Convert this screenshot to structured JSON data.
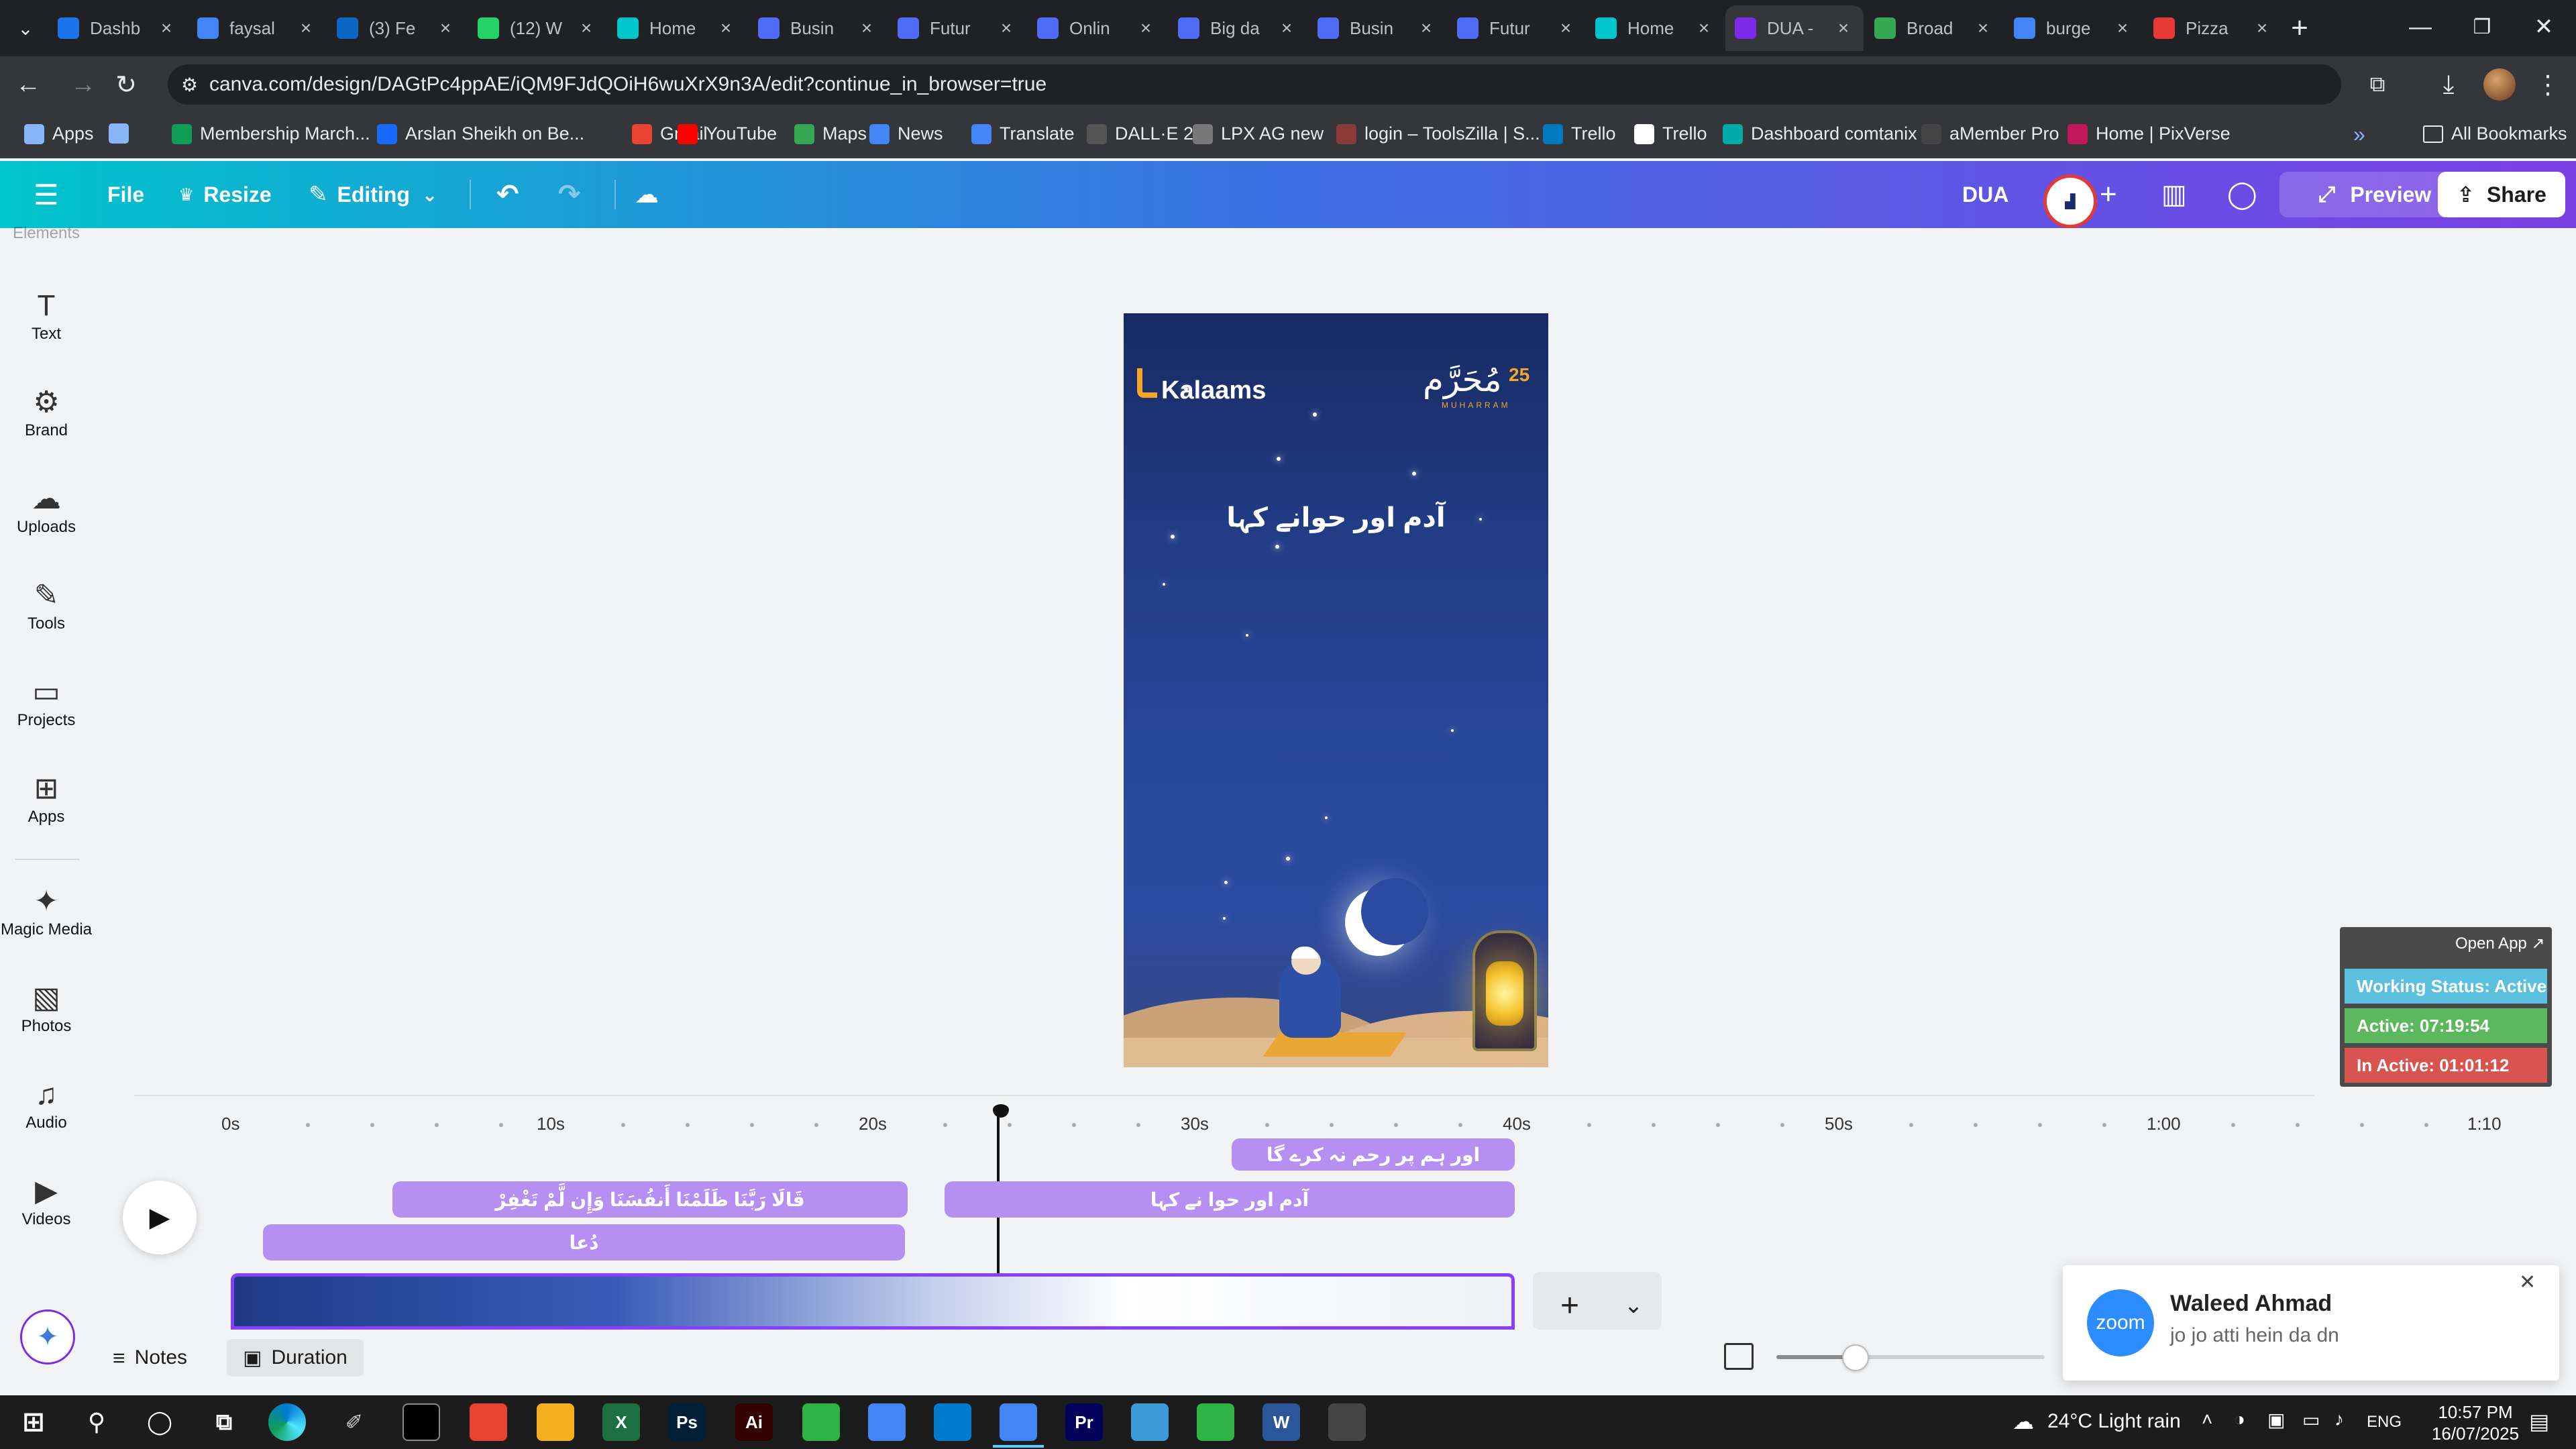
{
  "browser": {
    "tabs": [
      {
        "title": "Dashb",
        "icon": "dashboard-icon",
        "color": "#1a73e8"
      },
      {
        "title": "faysal",
        "icon": "google-icon",
        "color": "#4285f4"
      },
      {
        "title": "(3) Fe",
        "icon": "linkedin-icon",
        "color": "#0a66c2"
      },
      {
        "title": "(12) W",
        "icon": "whatsapp-icon",
        "color": "#25d366"
      },
      {
        "title": "Home",
        "icon": "canva-icon",
        "color": "#00c4cc"
      },
      {
        "title": "Busin",
        "icon": "forms-icon",
        "color": "#4f6cf5"
      },
      {
        "title": "Futur",
        "icon": "forms-icon",
        "color": "#4f6cf5"
      },
      {
        "title": "Onlin",
        "icon": "forms-icon",
        "color": "#4f6cf5"
      },
      {
        "title": "Big da",
        "icon": "forms-icon",
        "color": "#4f6cf5"
      },
      {
        "title": "Busin",
        "icon": "forms-icon",
        "color": "#4f6cf5"
      },
      {
        "title": "Futur",
        "icon": "forms-icon",
        "color": "#4f6cf5"
      },
      {
        "title": "Home",
        "icon": "canva-icon",
        "color": "#00c4cc"
      },
      {
        "title": "DUA -",
        "icon": "canva-icon",
        "color": "#7d2ae8",
        "active": true
      },
      {
        "title": "Broad",
        "icon": "broadband-icon",
        "color": "#34a853"
      },
      {
        "title": "burge",
        "icon": "google-icon",
        "color": "#4285f4"
      },
      {
        "title": "Pizza",
        "icon": "pizza-icon",
        "color": "#e53935"
      }
    ],
    "url": "canva.com/design/DAGtPc4ppAE/iQM9FJdQOiH6wuXrX9n3A/edit?continue_in_browser=true",
    "bookmarks": [
      {
        "label": "Apps",
        "icon": "apps-grid-icon",
        "color": "#8ab4f8"
      },
      {
        "label": "",
        "icon": "grid-icon",
        "color": "#8ab4f8"
      },
      {
        "label": "Membership March...",
        "icon": "plus-icon",
        "color": "#0f9d58"
      },
      {
        "label": "Arslan Sheikh on Be...",
        "icon": "behance-icon",
        "color": "#1769ff"
      },
      {
        "label": "Gmail",
        "icon": "gmail-icon",
        "color": "#ea4335"
      },
      {
        "label": "YouTube",
        "icon": "youtube-icon",
        "color": "#ff0000"
      },
      {
        "label": "Maps",
        "icon": "maps-icon",
        "color": "#34a853"
      },
      {
        "label": "News",
        "icon": "news-icon",
        "color": "#4285f4"
      },
      {
        "label": "Translate",
        "icon": "translate-icon",
        "color": "#4285f4"
      },
      {
        "label": "DALL·E 2",
        "icon": "openai-icon",
        "color": "#555555"
      },
      {
        "label": "LPX AG new",
        "icon": "dash-icon",
        "color": "#777777"
      },
      {
        "label": "login – ToolsZilla | S...",
        "icon": "toolszilla-icon",
        "color": "#8b3a3a"
      },
      {
        "label": "Trello",
        "icon": "trello-icon",
        "color": "#0079bf"
      },
      {
        "label": "Trello",
        "icon": "trello-icon",
        "color": "#ffffff"
      },
      {
        "label": "Dashboard comtanix",
        "icon": "comtanix-icon",
        "color": "#00a8a8"
      },
      {
        "label": "aMember Pro",
        "icon": "amember-icon",
        "color": "#444444"
      },
      {
        "label": "Home | PixVerse",
        "icon": "pixverse-icon",
        "color": "#c2185b"
      }
    ],
    "all_bookmarks": "All Bookmarks"
  },
  "canva": {
    "menu": {
      "file": "File",
      "resize": "Resize",
      "editing": "Editing"
    },
    "design_name": "DUA",
    "preview": "Preview",
    "share": "Share",
    "sidebar": [
      {
        "label": "Elements",
        "icon": "elements-icon"
      },
      {
        "label": "Text",
        "icon": "text-icon"
      },
      {
        "label": "Brand",
        "icon": "brand-icon"
      },
      {
        "label": "Uploads",
        "icon": "uploads-icon"
      },
      {
        "label": "Tools",
        "icon": "tools-icon"
      },
      {
        "label": "Projects",
        "icon": "projects-icon"
      },
      {
        "label": "Apps",
        "icon": "apps-icon"
      },
      {
        "label": "Magic Media",
        "icon": "magic-media-icon"
      },
      {
        "label": "Photos",
        "icon": "photos-icon"
      },
      {
        "label": "Audio",
        "icon": "audio-icon"
      },
      {
        "label": "Videos",
        "icon": "videos-icon"
      }
    ],
    "design": {
      "brand": "Kalaams",
      "badge_script": "مُحَرَّم",
      "badge_number": "25",
      "badge_sub": "MUHARRAM",
      "caption": "آدم اور حوانے کہا"
    },
    "timeline": {
      "ticks": [
        "0s",
        "10s",
        "20s",
        "30s",
        "40s",
        "50s",
        "1:00",
        "1:10"
      ],
      "clips": [
        "اور ہم پر رحم نہ کرے گا",
        "قَالَا رَبَّنَا ظَلَمْنَا أَنفُسَنَا وَإِن لَّمْ تَغْفِرْ",
        "آدم اور حوا نے کہا",
        "دُعا"
      ],
      "notes": "Notes",
      "duration": "Duration"
    }
  },
  "widget": {
    "open_app": "Open App ↗",
    "working_status": "Working Status: Active",
    "active": "Active: 07:19:54",
    "inactive": "In Active: 01:01:12",
    "colors": {
      "status": "#5bc0de",
      "active": "#5cb85c",
      "inactive": "#d9534f"
    }
  },
  "zoom_notification": {
    "app": "zoom",
    "name": "Waleed Ahmad",
    "message": "jo jo atti hein da dn"
  },
  "taskbar": {
    "weather": "24°C  Light rain",
    "language": "ENG",
    "time": "10:57 PM",
    "date": "16/07/2025",
    "apps": [
      {
        "name": "zoho-icon",
        "color": "#e94235",
        "label": ""
      },
      {
        "name": "file-explorer-icon",
        "color": "#f2b01e",
        "label": ""
      },
      {
        "name": "excel-icon",
        "color": "#1d6f42",
        "label": "X"
      },
      {
        "name": "photoshop-icon",
        "color": "#001e36",
        "label": "Ps"
      },
      {
        "name": "illustrator-icon",
        "color": "#330000",
        "label": "Ai"
      },
      {
        "name": "app-green-icon",
        "color": "#2fb344",
        "label": ""
      },
      {
        "name": "chrome-icon",
        "color": "#4285f4",
        "label": ""
      },
      {
        "name": "vscode-icon",
        "color": "#007acc",
        "label": ""
      },
      {
        "name": "chrome-icon",
        "color": "#4285f4",
        "label": ""
      },
      {
        "name": "premiere-icon",
        "color": "#00005b",
        "label": "Pr"
      },
      {
        "name": "app-teal-icon",
        "color": "#3c9bd6",
        "label": ""
      },
      {
        "name": "app-green-icon",
        "color": "#2fb344",
        "label": ""
      },
      {
        "name": "word-icon",
        "color": "#2b579a",
        "label": "W"
      },
      {
        "name": "media-player-icon",
        "color": "#444444",
        "label": ""
      }
    ]
  }
}
